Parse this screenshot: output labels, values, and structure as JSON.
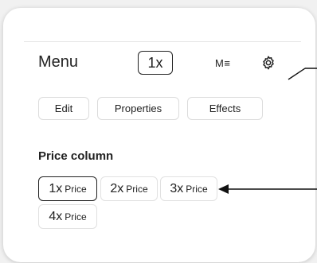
{
  "menu": {
    "title": "Menu",
    "multiplier": "1x",
    "markdown_icon_text": "M≡",
    "settings_icon": "gear-icon"
  },
  "toolbar": {
    "edit_label": "Edit",
    "properties_label": "Properties",
    "effects_label": "Effects"
  },
  "price_column": {
    "title": "Price column",
    "options": [
      {
        "mult": "1x",
        "label": "Price",
        "selected": true
      },
      {
        "mult": "2x",
        "label": "Price",
        "selected": false
      },
      {
        "mult": "3x",
        "label": "Price",
        "selected": false
      },
      {
        "mult": "4x",
        "label": "Price",
        "selected": false
      }
    ]
  },
  "colors": {
    "panel": "#ffffff",
    "background": "#f1f1f1",
    "border": "#dcdcdc",
    "text": "#222222"
  }
}
